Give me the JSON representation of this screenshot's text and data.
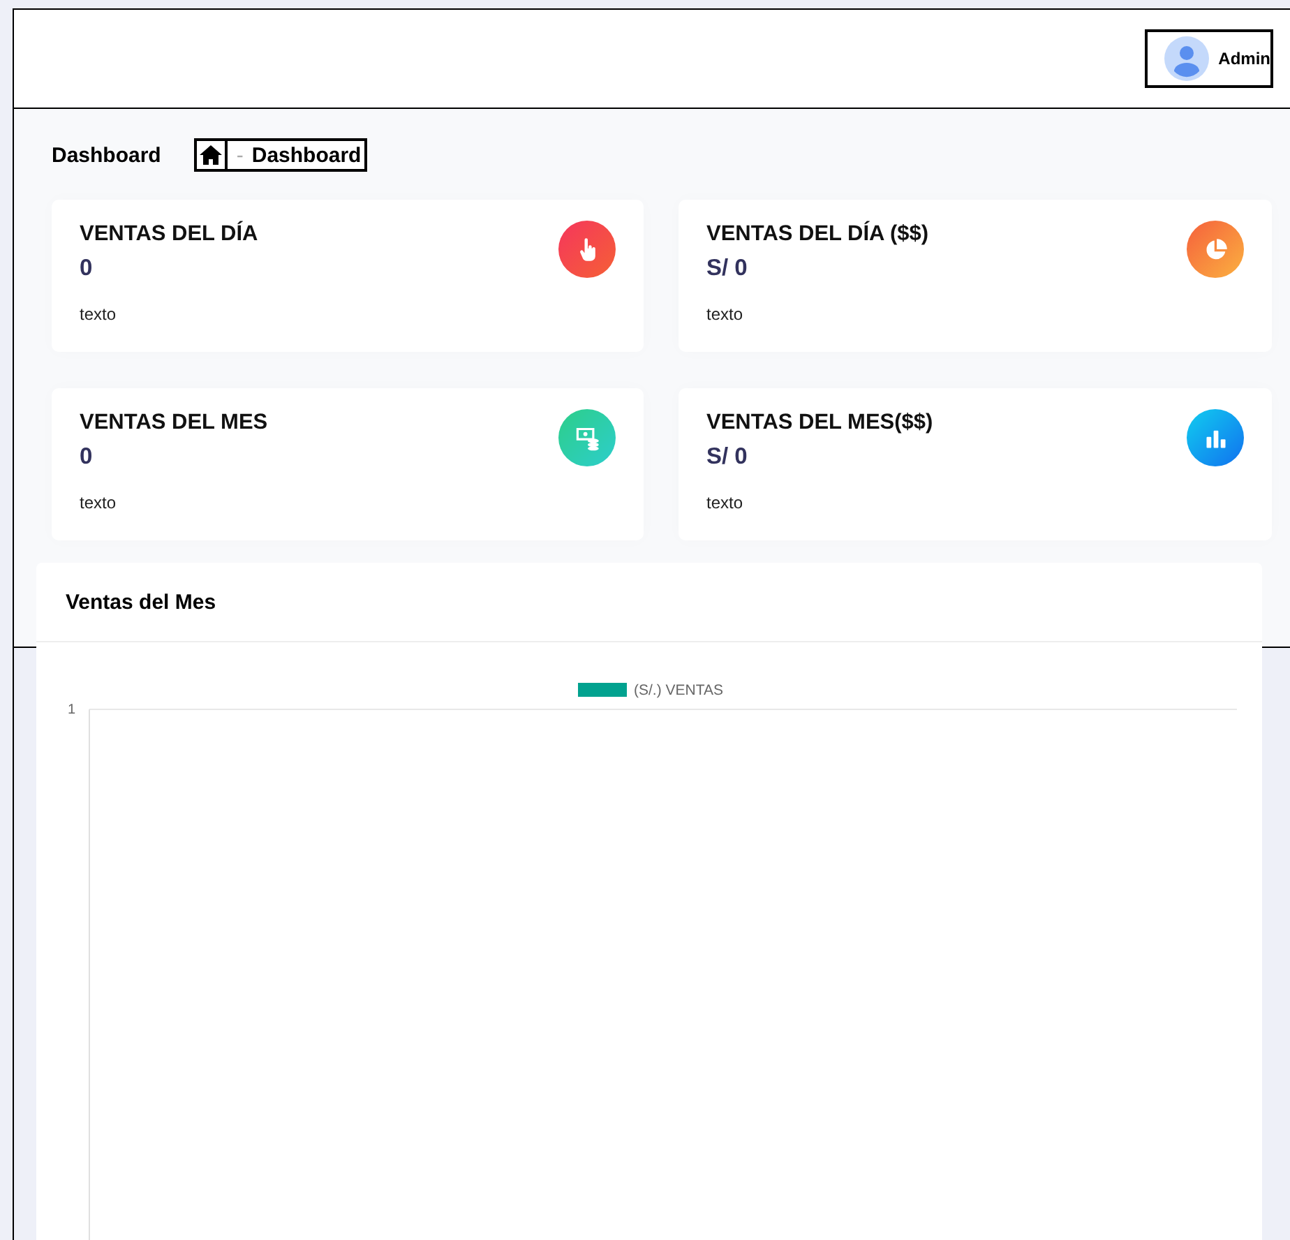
{
  "header": {
    "user": {
      "name": "Admin"
    }
  },
  "page": {
    "title": "Dashboard",
    "breadcrumb": {
      "separator": "-",
      "current": "Dashboard"
    }
  },
  "cards": [
    {
      "title": "VENTAS DEL DÍA",
      "value": "0",
      "note": "texto",
      "kind": "pointer"
    },
    {
      "title": "VENTAS DEL DÍA ($$)",
      "value": "S/ 0",
      "note": "texto",
      "kind": "pie"
    },
    {
      "title": "VENTAS DEL MES",
      "value": "0",
      "note": "texto",
      "kind": "money"
    },
    {
      "title": "VENTAS DEL MES($$)",
      "value": "S/ 0",
      "note": "texto",
      "kind": "bars"
    }
  ],
  "chart_panel": {
    "title": "Ventas del Mes",
    "chart_data": {
      "type": "other",
      "annotations": [
        {
          "text": "1"
        }
      ],
      "series": [
        {
          "name": "(S/.) VENTAS",
          "color": "#01a28f"
        }
      ]
    }
  }
}
